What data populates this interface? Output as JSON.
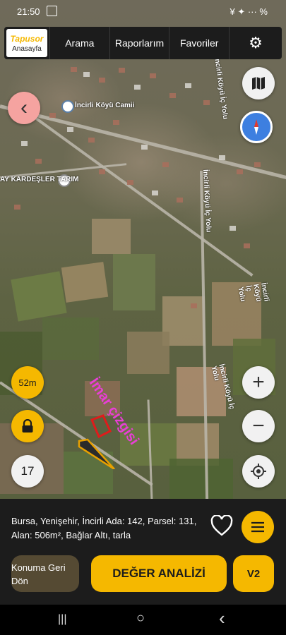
{
  "status_bar": {
    "time": "21:50",
    "right_text": "¥ ✦ ··· %"
  },
  "header": {
    "brand": "Tapusor",
    "home_label": "Anasayfa",
    "nav": [
      "Arama",
      "Raporlarım",
      "Favoriler"
    ],
    "settings_icon": "⚙"
  },
  "map": {
    "labels": {
      "mosque": "İncirli Köyü Camii",
      "company": "AY KARDEŞLER TARIM",
      "road1": "İncirli Köyü İç Yolu",
      "road2": "İncirli Köyü İç Yolu",
      "road3": "İncirli Köyü İç Yolu",
      "road4": "İncirli Köyü İç Yolu"
    },
    "annotation": "İmar çizgisi",
    "distance_label": "52m",
    "zoom_level": "17",
    "zoom_in": "+",
    "zoom_out": "−",
    "back_icon": "‹",
    "accent": "#f5b800"
  },
  "parcel": {
    "info": "Bursa, Yenişehir, İncirli Ada: 142, Parsel: 131, Alan: 506m², Bağlar Altı, tarla"
  },
  "buttons": {
    "konum_line1": "Konuma Geri",
    "konum_line2": "Dön",
    "deger": "DEĞER ANALİZİ",
    "v2": "V2"
  },
  "system_nav": {
    "recents": "|||",
    "home": "○",
    "back": "‹"
  }
}
